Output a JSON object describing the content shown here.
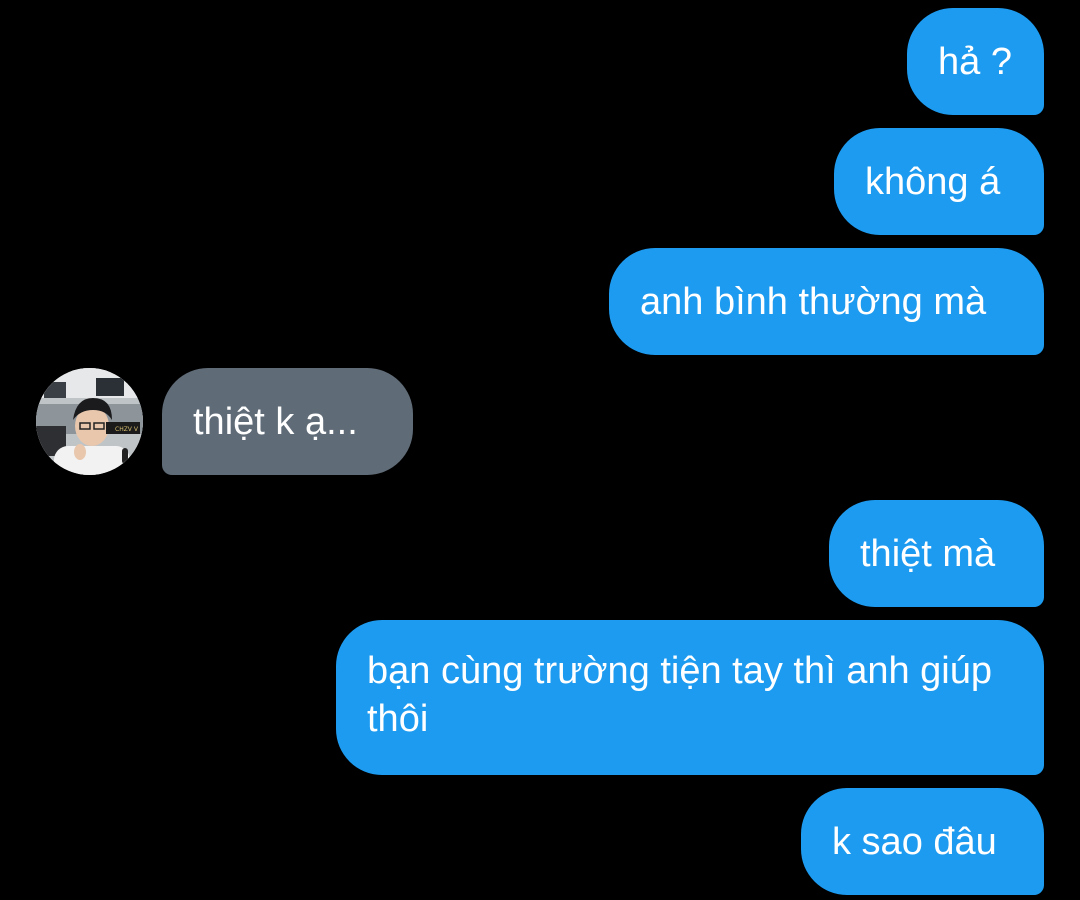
{
  "conversation": {
    "messages": [
      {
        "sender": "me",
        "text": "hả ?"
      },
      {
        "sender": "me",
        "text": "không á"
      },
      {
        "sender": "me",
        "text": "anh bình thường mà"
      },
      {
        "sender": "other",
        "text": "thiệt k ạ..."
      },
      {
        "sender": "me",
        "text": "thiệt mà"
      },
      {
        "sender": "me",
        "text": "bạn cùng trường tiện tay thì anh giúp thôi"
      },
      {
        "sender": "me",
        "text": "k sao đâu"
      }
    ]
  },
  "avatar": {
    "icon": "user-photo-avatar",
    "overlay_text": "CHZV V"
  },
  "colors": {
    "background": "#000000",
    "outgoing_bubble": "#1d9bf0",
    "incoming_bubble": "#5f6b77",
    "text": "#ffffff"
  }
}
